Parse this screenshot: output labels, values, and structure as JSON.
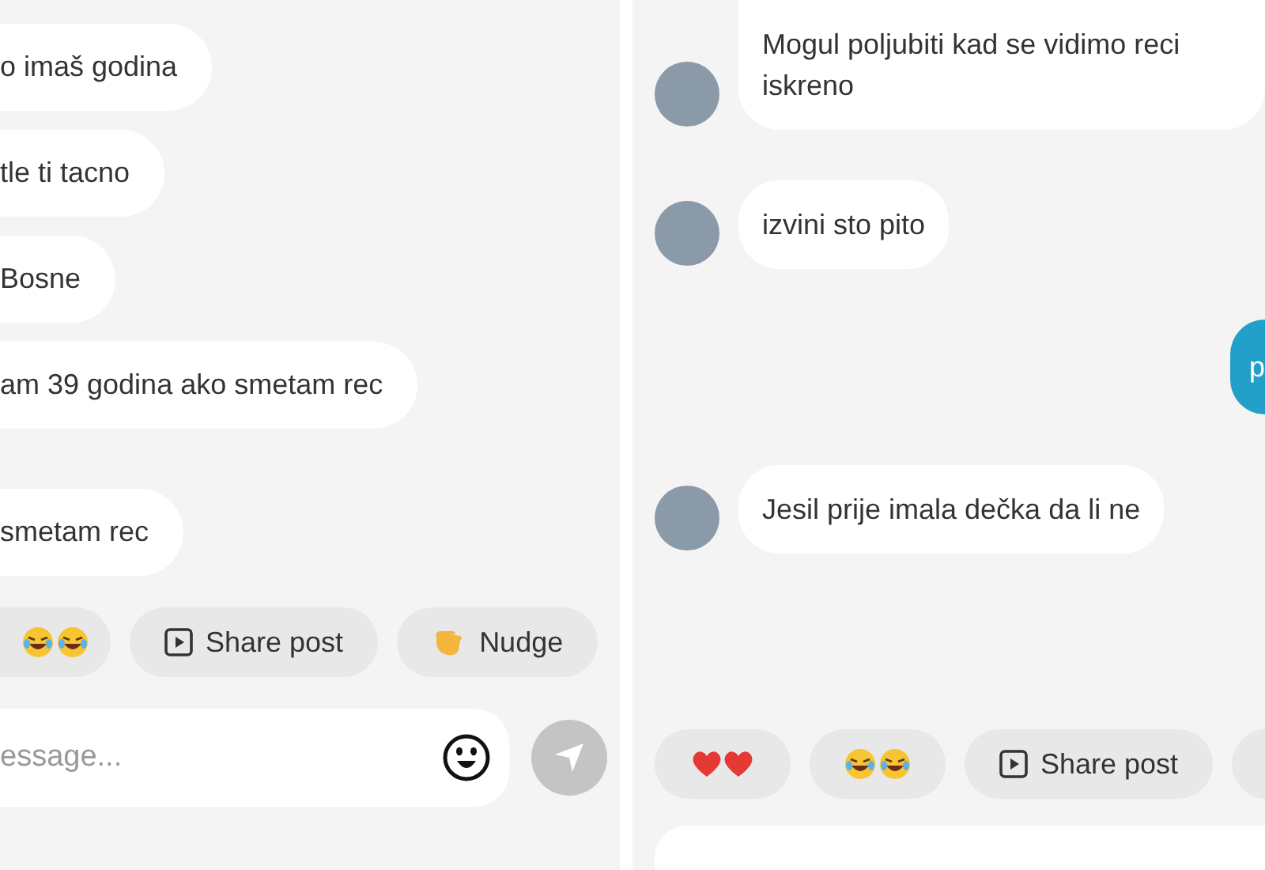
{
  "left_chat": {
    "messages": [
      {
        "text": "o imaš godina"
      },
      {
        "text": "tle ti tacno"
      },
      {
        "text": "Bosne"
      },
      {
        "text": "am 39 godina ako smetam rec"
      },
      {
        "text": "smetam rec"
      }
    ],
    "quick_replies": [
      {
        "kind": "laughs"
      },
      {
        "kind": "share",
        "label": "Share post"
      },
      {
        "kind": "nudge",
        "label": "Nudge"
      }
    ],
    "composer": {
      "placeholder": "essage..."
    }
  },
  "right_chat": {
    "messages": [
      {
        "kind": "received",
        "text": "Mogul poljubiti kad se vidimo reci iskreno"
      },
      {
        "kind": "received",
        "text": "izvini sto pito"
      },
      {
        "kind": "sent",
        "text": "p"
      },
      {
        "kind": "received",
        "text": "Jesil prije imala dečka da li ne"
      }
    ],
    "quick_replies": [
      {
        "kind": "hearts"
      },
      {
        "kind": "laughs"
      },
      {
        "kind": "share",
        "label": "Share post"
      },
      {
        "kind": "cut"
      }
    ]
  }
}
